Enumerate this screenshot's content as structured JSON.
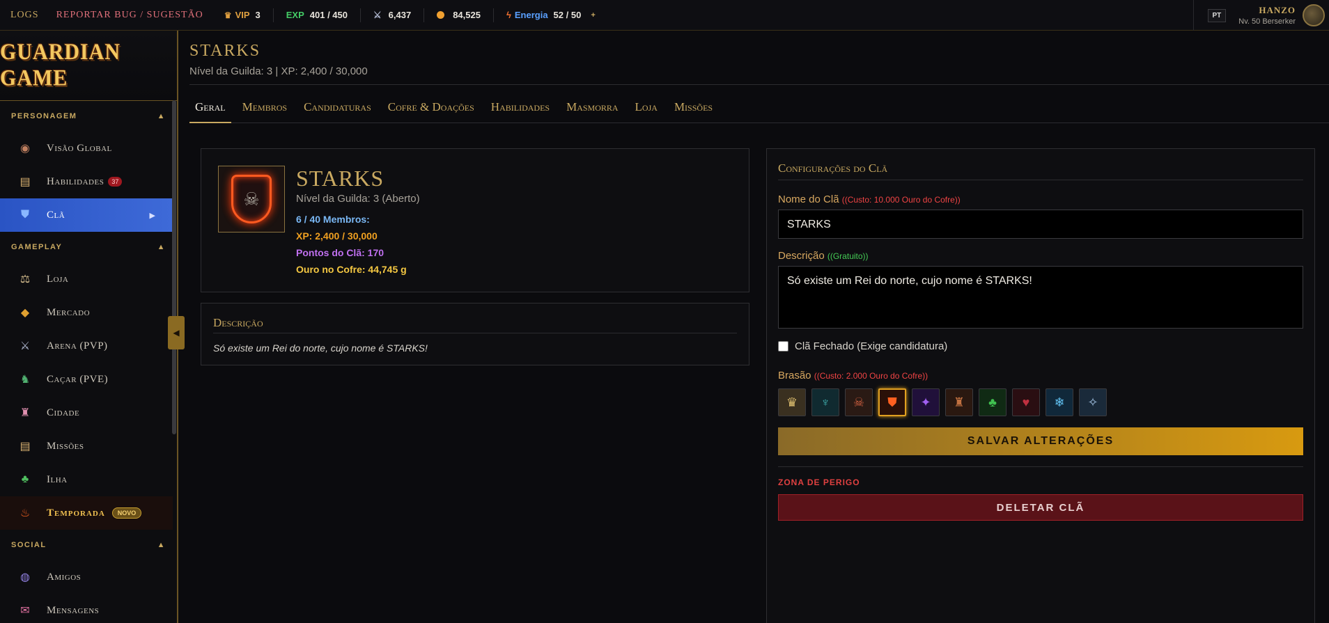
{
  "topbar": {
    "logs": "LOGS",
    "report": "REPORTAR BUG / SUGESTÃO",
    "vip_label": "VIP",
    "vip_value": "3",
    "exp_label": "EXP",
    "exp_value": "401 / 450",
    "power_value": "6,437",
    "gold_value": "84,525",
    "energy_label": "Energia",
    "energy_value": "52 / 50",
    "energy_plus": "+",
    "lang": "PT",
    "user_name": "HANZO",
    "user_level": "Nv. 50 Berserker"
  },
  "sidebar": {
    "logo": "GUARDIAN GAME",
    "sections": {
      "personagem": "PERSONAGEM",
      "gameplay": "GAMEPLAY",
      "social": "SOCIAL"
    },
    "items": {
      "visao": "Visão Global",
      "habilidades": "Habilidades",
      "habilidades_badge": "37",
      "cla": "Clã",
      "loja": "Loja",
      "mercado": "Mercado",
      "arena": "Arena (PVP)",
      "cacar": "Caçar (PVE)",
      "cidade": "Cidade",
      "missoes": "Missões",
      "ilha": "Ilha",
      "temporada": "Temporada",
      "temporada_badge": "NOVO",
      "amigos": "Amigos",
      "mensagens": "Mensagens"
    }
  },
  "header": {
    "title": "STARKS",
    "subtitle": "Nível da Guilda: 3 | XP: 2,400 / 30,000"
  },
  "tabs": [
    "Geral",
    "Membros",
    "Candidaturas",
    "Cofre & Doações",
    "Habilidades",
    "Masmorra",
    "Loja",
    "Missões"
  ],
  "info": {
    "name": "STARKS",
    "level": "Nível da Guilda: 3 (Aberto)",
    "members": "6 / 40 Membros:",
    "xp": "XP: 2,400 / 30,000",
    "points": "Pontos do Clã: 170",
    "gold": "Ouro no Cofre: 44,745 g"
  },
  "description": {
    "title": "Descrição",
    "text": "Só existe um Rei do norte, cujo nome é STARKS!"
  },
  "config": {
    "title": "Configurações do Clã",
    "name_label": "Nome do Clã",
    "name_cost": "((Custo: 10.000 Ouro do Cofre))",
    "name_value": "STARKS",
    "desc_label": "Descrição",
    "desc_cost": "((Gratuito))",
    "desc_value": "Só existe um Rei do norte, cujo nome é STARKS!",
    "closed_label": "Clã Fechado (Exige candidatura)",
    "crest_label": "Brasão",
    "crest_cost": "((Custo: 2.000 Ouro do Cofre))",
    "save": "SALVAR ALTERAÇÕES",
    "danger": "ZONA DE PERIGO",
    "delete": "DELETAR CLÃ"
  },
  "colors": {
    "gold": "#c9a961",
    "active_nav": "#3e6ad8",
    "danger": "#e04040",
    "members": "#7ab8f5",
    "xp": "#f0a020",
    "points": "#c070f0",
    "gold_stat": "#f5c842"
  }
}
